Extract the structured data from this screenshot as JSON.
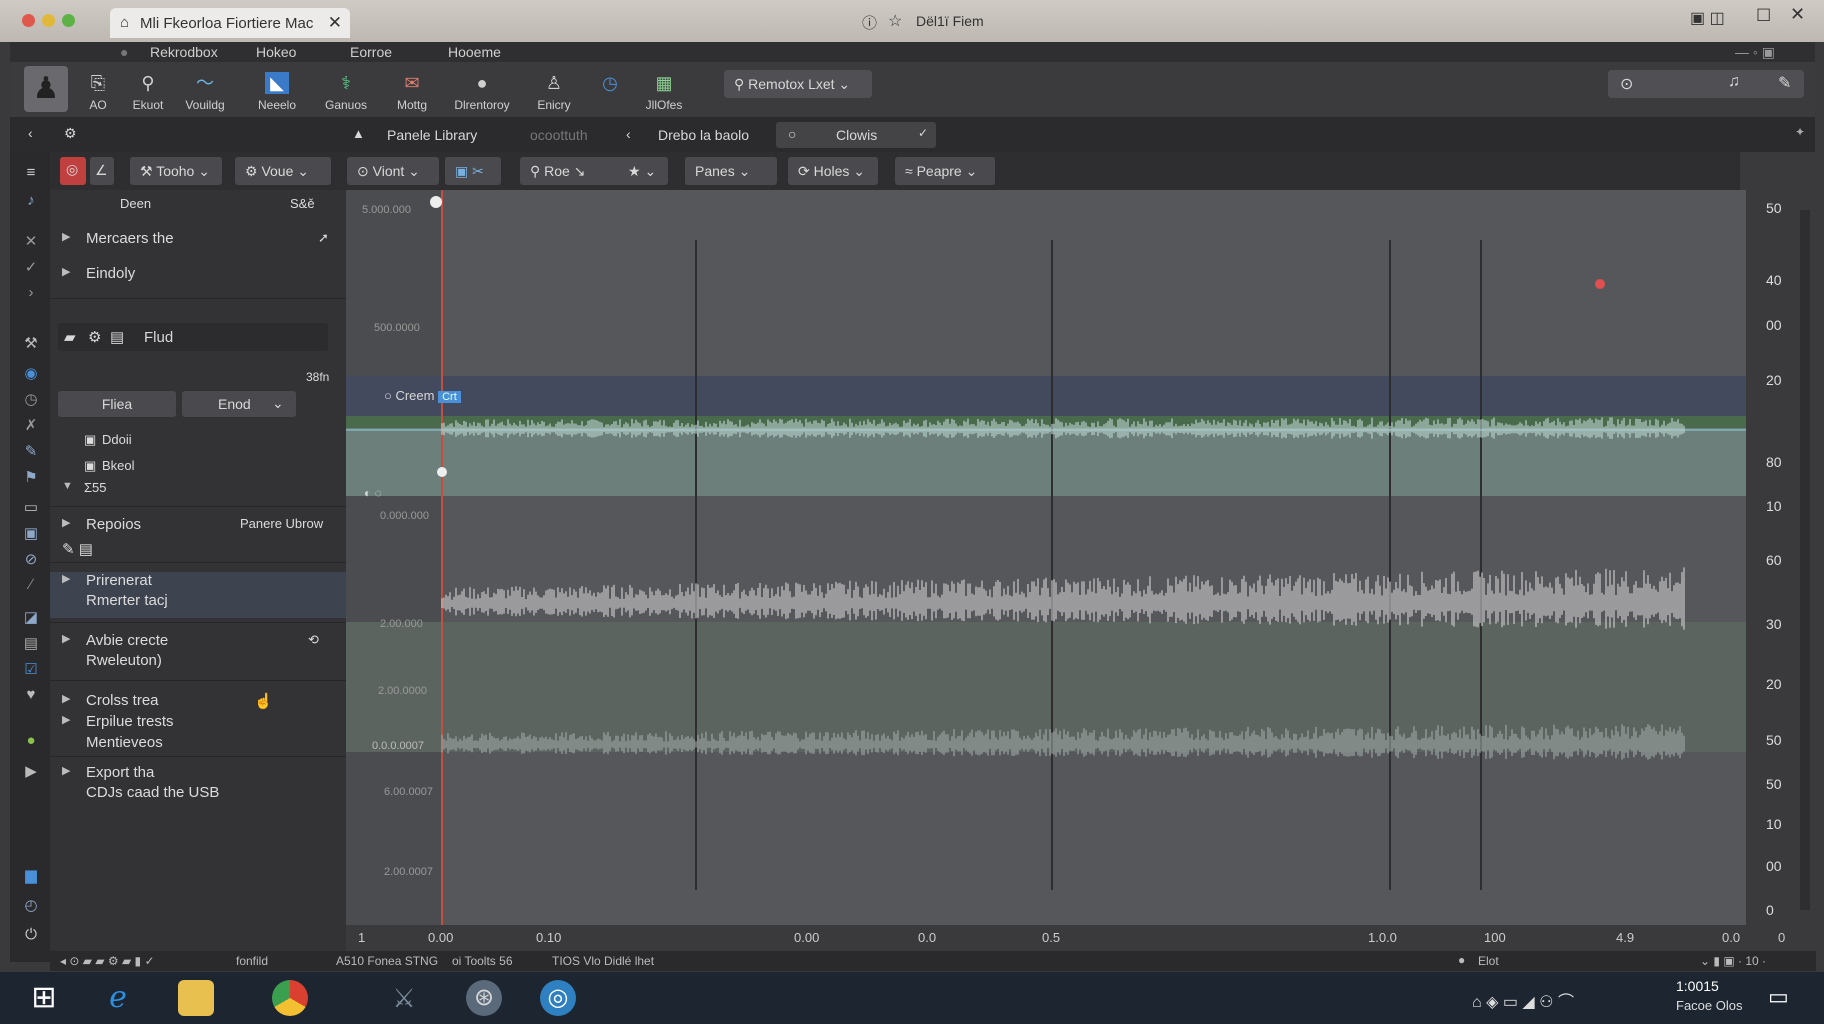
{
  "window": {
    "tab_title": "Mli Fkeorloa Fiortiere Mac",
    "center_title": "Dël1ï Fiem"
  },
  "menu": [
    "Rekrodbox",
    "Hokeo",
    "Eorroe",
    "Hooeme"
  ],
  "toolbar": [
    {
      "icon": "user-icon",
      "label": ""
    },
    {
      "icon": "doc-icon",
      "label": "AO"
    },
    {
      "icon": "pin-icon",
      "label": "Ekuot"
    },
    {
      "icon": "wave-icon",
      "label": "Vouildg"
    },
    {
      "icon": "monitor-icon",
      "label": "Neeelo"
    },
    {
      "icon": "dna-icon",
      "label": "Ganuos"
    },
    {
      "icon": "mail-icon",
      "label": "Mottg"
    },
    {
      "icon": "record-icon",
      "label": "Dlrentoroy"
    },
    {
      "icon": "profile-icon",
      "label": "Enicry"
    },
    {
      "icon": "clock-icon",
      "label": ""
    },
    {
      "icon": "grid-icon",
      "label": "JllOfes"
    }
  ],
  "search_box": "Remotox Lxet",
  "nav": {
    "library": "Panele Library",
    "crumb2": "ocoottuth",
    "crumb3": "Drebo la baolo",
    "clovis": "Clowis"
  },
  "filters": [
    "Tooho",
    "Voue",
    "Viont",
    "Roe",
    "Panes",
    "Holes",
    "Peapre"
  ],
  "sidebar": {
    "col1": "Deen",
    "col2": "S&ě",
    "items_top": [
      "Mercaers the",
      "Eindoly"
    ],
    "find": "Flud",
    "count": "38fn",
    "btn1": "Fliea",
    "btn2": "Enod",
    "tree": [
      "Ddoii",
      "Bkeol",
      "Σ55"
    ],
    "r_label": "Repoios",
    "r_right": "Panere Ubrow",
    "prim1": "Prirenerat",
    "prim2": "Rmerter tacj",
    "audio1": "Avbie crecte",
    "audio2": "Rweleuton)",
    "cross1": "Crolss trea",
    "cross2": "Erpilue trests",
    "cross3": "Mentieveos",
    "exp1": "Export tha",
    "exp2": "CDJs caad the USB"
  },
  "track": {
    "label": "Creem",
    "tag": "Crt"
  },
  "scale": [
    "50",
    "40",
    "00",
    "20",
    "80",
    "10",
    "60",
    "30",
    "20",
    "50",
    "50",
    "10",
    "00",
    "0"
  ],
  "gridlabels": [
    "5.000.000",
    "500.0000",
    "0.000.000",
    "2.00.000",
    "2.00.0000",
    "0.0.0.0007",
    "6.00.0007",
    "2.00.0007"
  ],
  "timeline": [
    "1",
    "0.00",
    "0.10",
    "0.00",
    "0.0",
    "0.5",
    "1.0.0",
    "100",
    "4.9",
    "0.0",
    "0"
  ],
  "status": {
    "left": "fonfild",
    "mid": "A510 Fonea STNG",
    "mid2": "oi Toolts 56",
    "mid3": "TIOS Vlo Didlé lhet",
    "right": "Elot"
  },
  "clock": {
    "time": "1:0015",
    "date": "Facoe Olos"
  },
  "colors": {
    "playhead": "#d04a3a",
    "wave": "#c8c8c8",
    "accent": "#4a90d9"
  }
}
